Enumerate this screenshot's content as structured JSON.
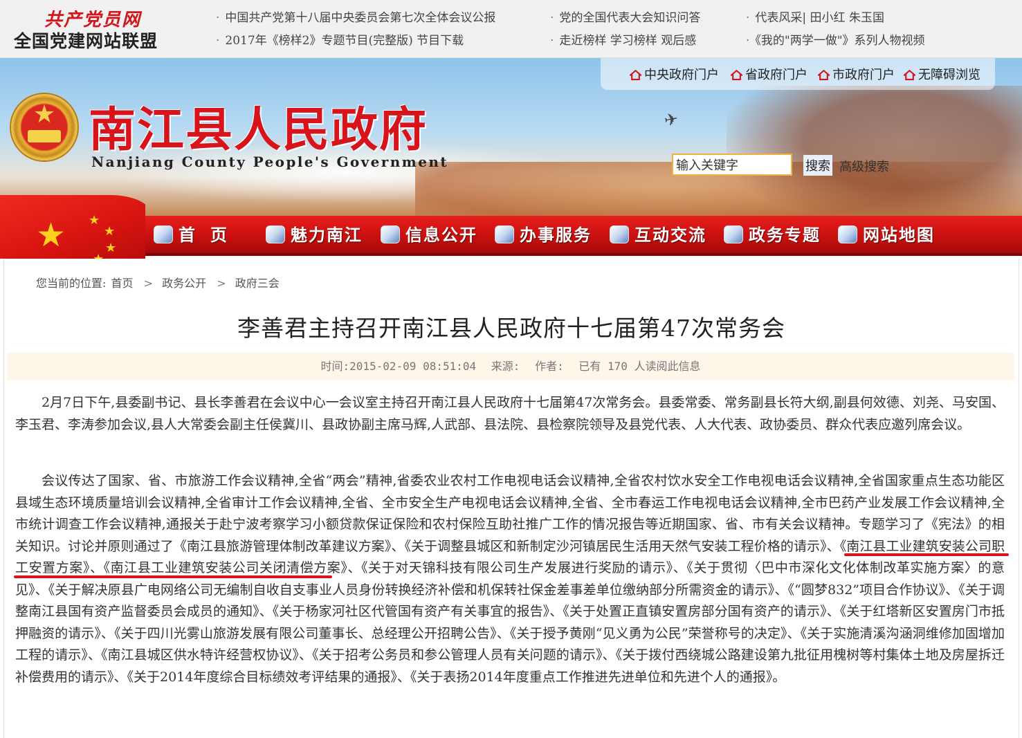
{
  "alliance": {
    "script_name": "共产党员网",
    "name": "全国党建网站联盟"
  },
  "news_links": {
    "col1": [
      "中国共产党第十八届中央委员会第七次全体会议公报",
      "2017年《榜样2》专题节目(完整版) 节目下载"
    ],
    "col2": [
      "党的全国代表大会知识问答",
      "走近榜样 学习榜样 观后感"
    ],
    "col3": [
      "代表风采| 田小红 朱玉国",
      "《我的\"两学一做\"》系列人物视频"
    ]
  },
  "portal_links": [
    "中央政府门户",
    "省政府门户",
    "市政府门户",
    "无障碍浏览"
  ],
  "site": {
    "title": "南江县人民政府",
    "subtitle": "Nanjiang County People's Government"
  },
  "search": {
    "value": "输入关键字",
    "button": "搜索",
    "advanced": "高级搜索"
  },
  "nav": [
    "首页",
    "魅力南江",
    "信息公开",
    "办事服务",
    "互动交流",
    "政务专题",
    "网站地图"
  ],
  "breadcrumb": {
    "prefix": "您当前的位置:",
    "items": [
      "首页",
      "政务公开",
      "政府三会"
    ],
    "separator": ">"
  },
  "article": {
    "title": "李善君主持召开南江县人民政府十七届第47次常务会",
    "meta": {
      "time": "时间:2015-02-09 08:51:04",
      "source": "来源:",
      "author": "作者:",
      "views": "已有 170 人读阅此信息"
    },
    "paragraph1": "2月7日下午,县委副书记、县长李善君在会议中心一会议室主持召开南江县人民政府十七届第47次常务会。县委常委、常务副县长符大纲,副县何效德、刘尧、马安国、李玉君、李涛参加会议,县人大常委会副主任侯冀川、县政协副主席马辉,人武部、县法院、县检察院领导及县党代表、人大代表、政协委员、群众代表应邀列席会议。",
    "paragraph2": "会议传达了国家、省、市旅游工作会议精神,全省“两会”精神,省委农业农村工作电视电话会议精神,全省农村饮水安全工作电视电话会议精神,全省国家重点生态功能区县域生态环境质量培训会议精神,全省审计工作会议精神,全省、全市安全生产电视电话会议精神,全省、全市春运工作电视电话会议精神,全市巴药产业发展工作会议精神,全市统计调查工作会议精神,通报关于赴宁波考察学习小额贷款保证保险和农村保险互助社推广工作的情况报告等近期国家、省、市有关会议精神。专题学习了《宪法》的相关知识。讨论并原则通过了《南江县旅游管理体制改革建议方案》、《关于调整县城区和新制定沙河镇居民生活用天然气安装工程价格的请示》、《南江县工业建筑安装公司职工安置方案》、《南江县工业建筑安装公司关闭清偿方案》、《关于对天锦科技有限公司生产发展进行奖励的请示》、《关于贯彻〈巴中市深化文化体制改革实施方案〉的意见》、《关于解决原县广电网络公司无编制自收自支事业人员身份转换经济补偿和机保转社保金差事差单位缴纳部分所需资金的请示》、《“圆梦832”项目合作协议》、《关于调整南江县国有资产监督委员会成员的通知》、《关于杨家河社区代管国有资产有关事宜的报告》、《关于处置正直镇安置房部分国有资产的请示》、《关于红塔新区安置房门市抵押融资的请示》、《关于四川光雾山旅游发展有限公司董事长、总经理公开招聘公告》、《关于授予黄刚“见义勇为公民”荣誉称号的决定》、《关于实施清溪沟涵洞维修加固增加工程的请示》、《南江县城区供水特许经营权协议》、《关于招考公务员和参公管理人员有关问题的请示》、《关于拨付西绕城公路建设第九批征用槐树等村集体土地及房屋拆迁补偿费用的请示》、《关于2014年度综合目标绩效考评结果的通报》、《关于表扬2014年度重点工作推进先进单位和先进个人的通报》。"
  },
  "colors": {
    "brand_red": "#d7141b",
    "nav_red": "#c9100f",
    "meta_bg": "#fdf6e9"
  }
}
